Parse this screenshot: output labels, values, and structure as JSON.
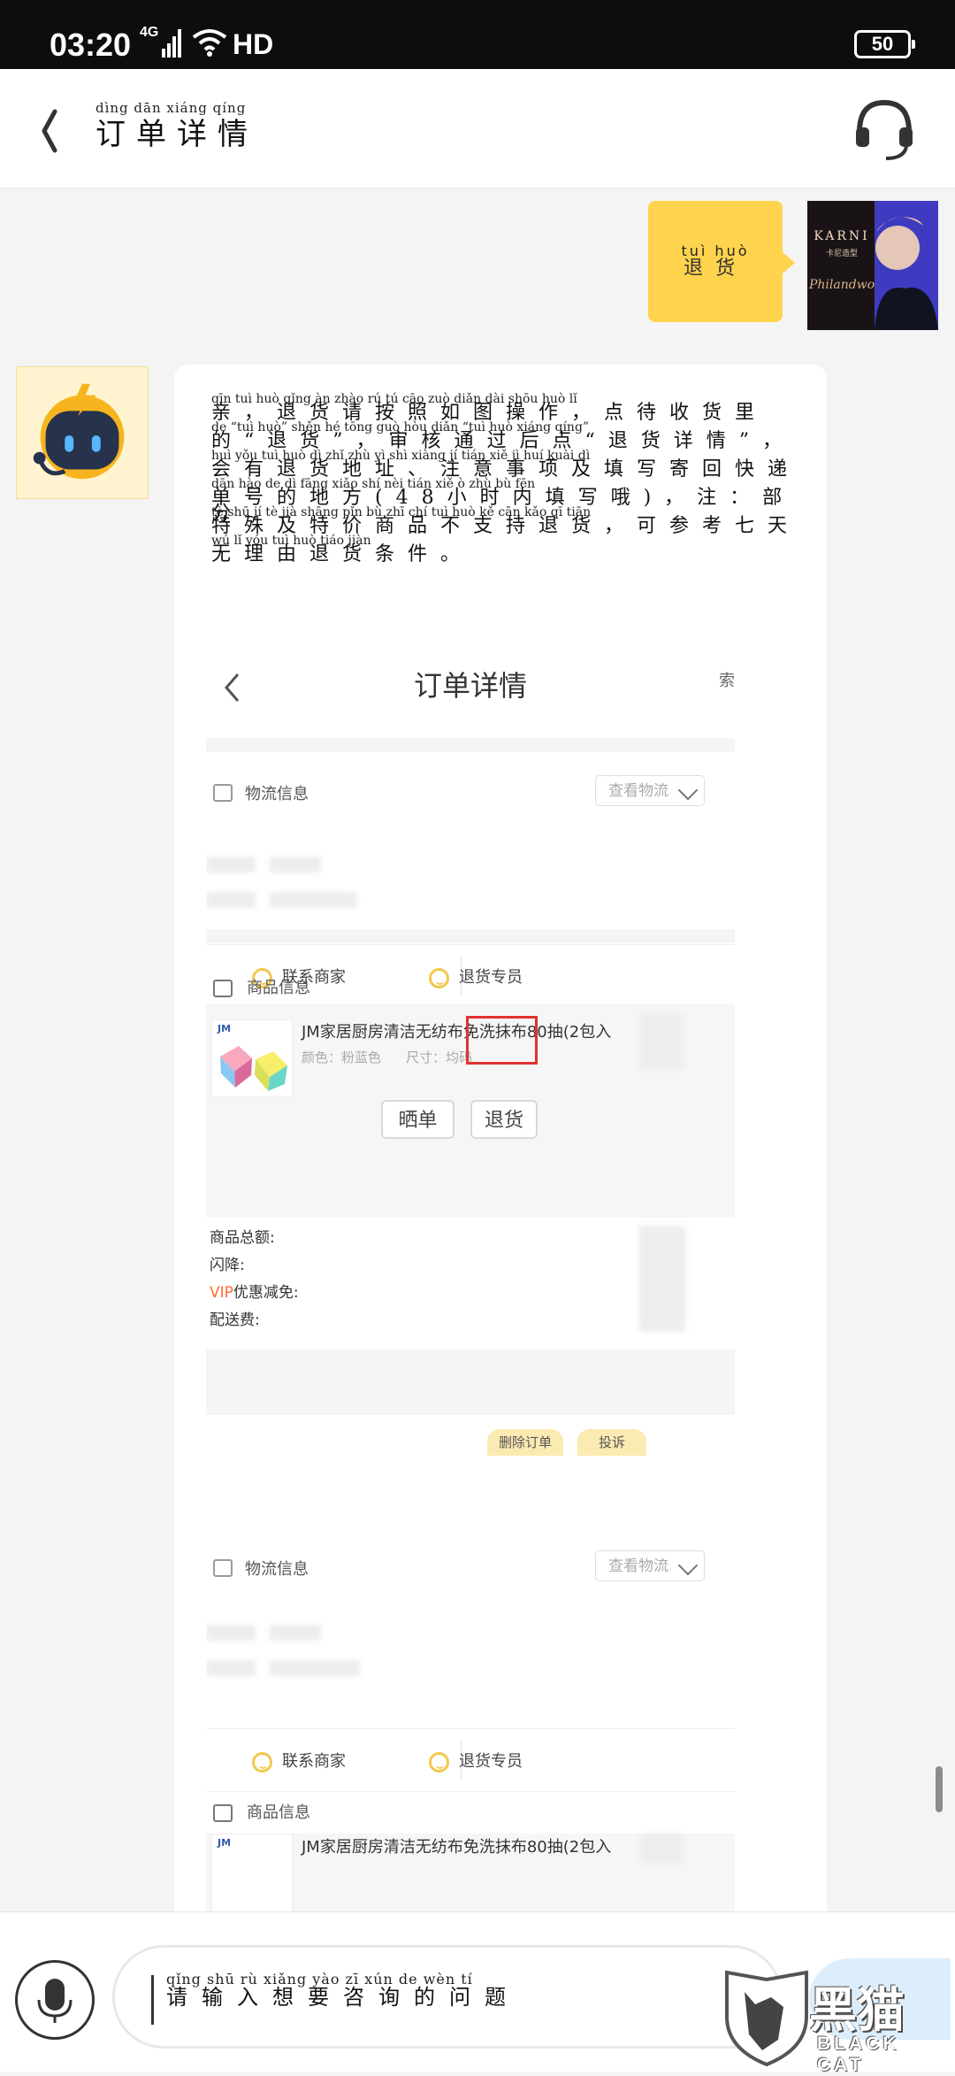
{
  "status_bar": {
    "time": "03:20",
    "network": "4G",
    "hd": "HD",
    "battery": "50"
  },
  "header": {
    "title_pinyin": "dìng dān xiáng qíng",
    "title": "订单详情"
  },
  "user_message": {
    "pinyin": "tuì huò",
    "text": "退货"
  },
  "user_avatar": {
    "brand": "KARNI",
    "brand_sub_small": "卡尼造型",
    "script_text": "Philandwo"
  },
  "bot_message": {
    "lines": [
      {
        "pinyin": "qīn tuì huò qǐng àn zhào rú tú cāo zuò diǎn dài shōu huò lǐ",
        "text": "亲，退货请按照如图操作，点待收货里"
      },
      {
        "pinyin": "de “tuì huò” shěn hé tōng guò hòu diǎn “tuì huò xiáng qíng”",
        "text": "的“退货”，审核通过后点“退货详情”，"
      },
      {
        "pinyin": "huì yǒu tuì huò dì zhǐ zhù yì shì xiàng jí tián xiě jì huí kuài dì",
        "text": "会有退货地址、注意事项及填写寄回快递"
      },
      {
        "pinyin": "dān hào de dì fāng xiǎo shí nèi tián xiě ò zhù bù fēn",
        "text": "单号的地方(48小时内填写哦)，注：部分"
      },
      {
        "pinyin": "tè shū jí tè jià shāng pǐn bù zhī chí tuì huò kě cān kǎo qī tiān",
        "text": "特殊及特价商品不支持退货，可参考七天"
      },
      {
        "pinyin": "wú lǐ yóu tuì huò tiáo jiàn",
        "text": "无理由退货条件。"
      }
    ]
  },
  "order_screenshot": {
    "title": "订单详情",
    "cut_text": "索",
    "logistics_label": "物流信息",
    "view_logistics": "查看物流",
    "contact_merchant": "联系商家",
    "return_specialist": "退货专员",
    "goods_label": "商品信息",
    "product_brand": "JM",
    "product_name": "JM家居厨房清洁无纺布免洗抹布80抽(2包入",
    "color_label": "颜色：粉蓝色",
    "size_label": "尺寸：均码",
    "share_button": "晒单",
    "return_button": "退货",
    "summary_total": "商品总额:",
    "summary_flash": "闪降:",
    "summary_vip_prefix": "VIP",
    "summary_vip": "优惠减免:",
    "summary_shipping": "配送费:",
    "delete_order": "删除订单",
    "complaint": "投诉"
  },
  "order_screenshot_2": {
    "logistics_label": "物流信息",
    "view_logistics": "查看物流",
    "contact_merchant": "联系商家",
    "return_specialist": "退货专员",
    "goods_label": "商品信息",
    "product_brand": "JM",
    "product_name": "JM家居厨房清洁无纺布免洗抹布80抽(2包入"
  },
  "input": {
    "pinyin": "qǐng shū rù xiǎng yào zī xún de wèn tí",
    "placeholder": "请输入想要咨询的问题"
  },
  "watermark": {
    "main": "黑猫",
    "sub": "BLACK CAT"
  },
  "colors": {
    "yellow": "#ffd34e",
    "red_box": "#e13131",
    "vip": "#ff6d2c"
  }
}
